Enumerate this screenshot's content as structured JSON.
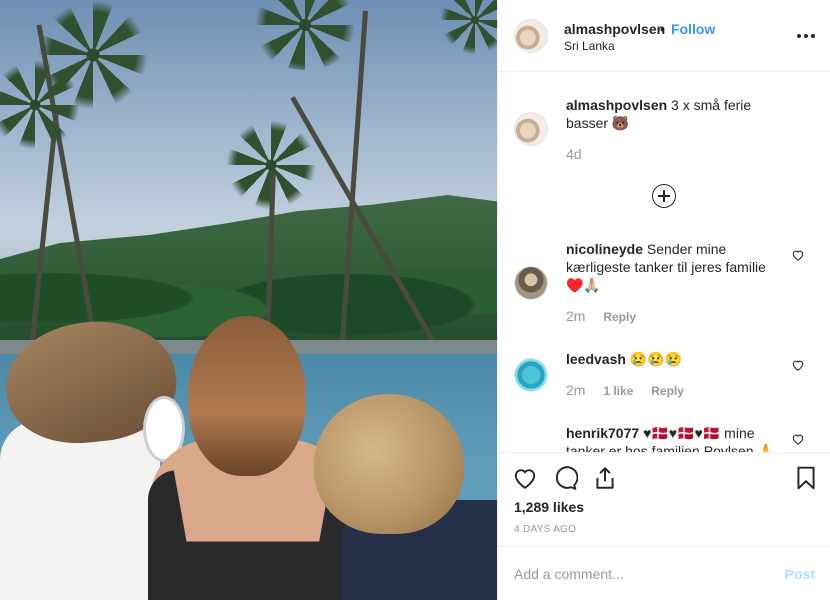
{
  "post": {
    "username": "almashpovlsen",
    "separator": "•",
    "follow_label": "Follow",
    "location": "Sri Lanka",
    "caption_user": "almashpovlsen",
    "caption_text": "3 x små ferie basser 🐻",
    "caption_age": "4d"
  },
  "comments": [
    {
      "user": "nicolineyde",
      "text": "Sender mine kærligeste tanker til jeres familie ♥️🙏🏼",
      "age": "2m",
      "likes": "",
      "reply": "Reply"
    },
    {
      "user": "leedvash",
      "text": "😢😢😢",
      "age": "2m",
      "likes": "1 like",
      "reply": "Reply"
    },
    {
      "user": "henrik7077",
      "text": "♥🇩🇰♥🇩🇰♥🇩🇰 mine tanker er hos familien Povlsen 🙏",
      "age": "",
      "likes": "",
      "reply": ""
    }
  ],
  "stats": {
    "likes": "1,289 likes",
    "posted": "4 DAYS AGO"
  },
  "add_comment": {
    "placeholder": "Add a comment...",
    "post_label": "Post"
  },
  "icons": {
    "more": "more-options-icon",
    "like": "heart-icon",
    "comment": "comment-icon",
    "share": "share-icon",
    "save": "bookmark-icon",
    "load_more": "plus-circle-icon"
  },
  "colors": {
    "link_blue": "#3897f0",
    "post_disabled": "#b2dffc",
    "muted": "#999999",
    "text": "#262626",
    "border": "#efefef"
  }
}
